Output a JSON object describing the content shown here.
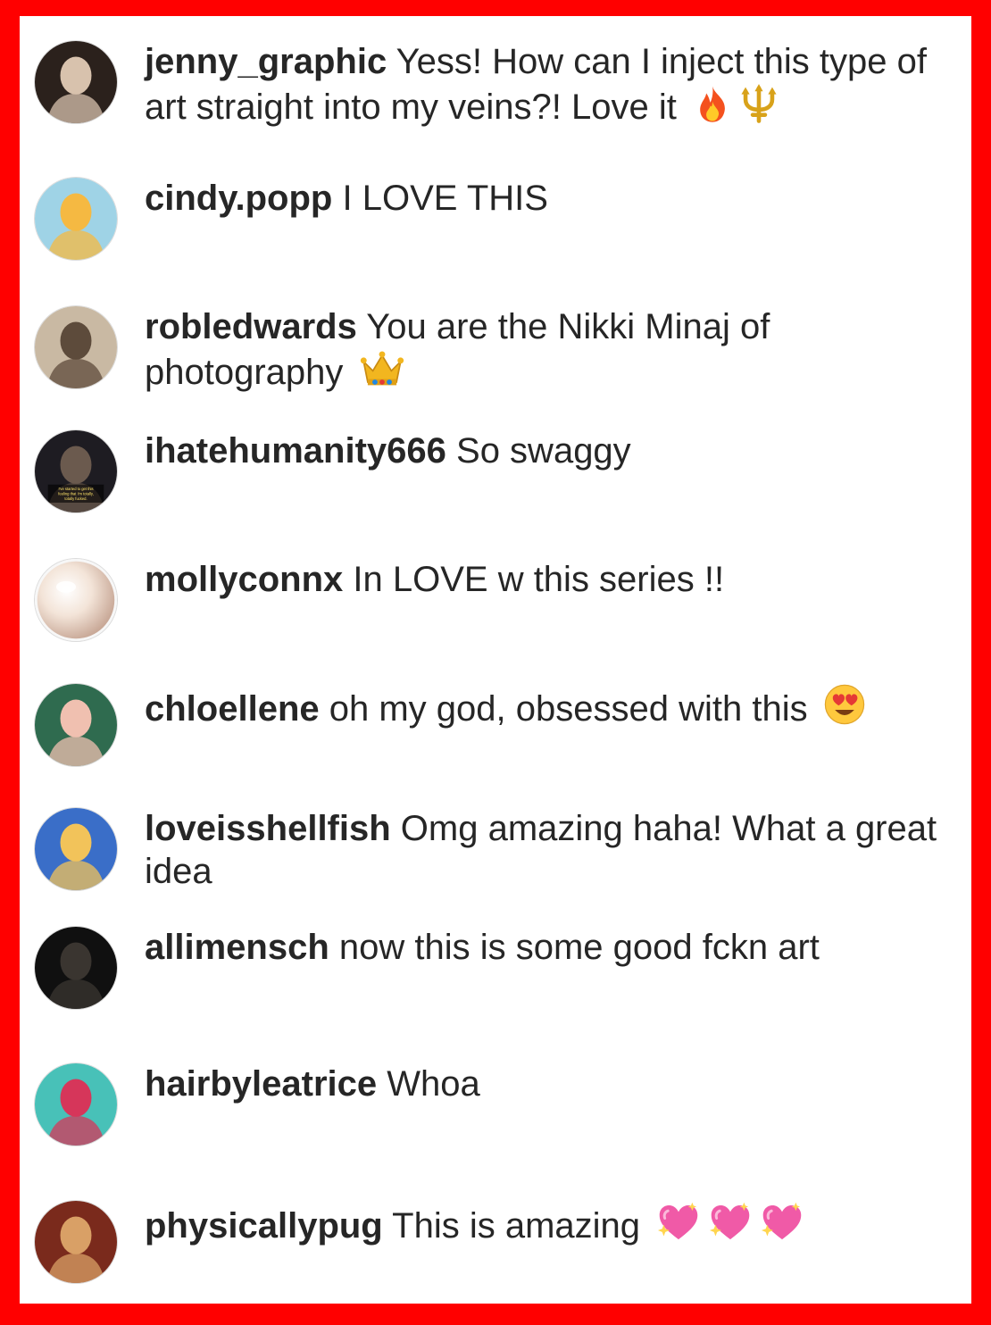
{
  "comments": [
    {
      "username": "jenny_graphic",
      "text": "Yess! How can I inject this type of art straight into my veins?! Love it",
      "emojis": [
        "fire-icon",
        "trident-icon"
      ],
      "avatar": {
        "bg": "#2b211c",
        "fg": "#d8c2ad"
      }
    },
    {
      "username": "cindy.popp",
      "text": "I LOVE THIS",
      "emojis": [],
      "avatar": {
        "bg": "#9fd3e6",
        "fg": "#f5b942"
      }
    },
    {
      "username": "robledwards",
      "text": "You are the Nikki Minaj of photography",
      "emojis": [
        "crown-icon"
      ],
      "avatar": {
        "bg": "#c9b9a3",
        "fg": "#5d4b3b"
      }
    },
    {
      "username": "ihatehumanity666",
      "text": "So swaggy",
      "emojis": [],
      "avatar": {
        "bg": "#1e1c22",
        "fg": "#6b5a4e",
        "caption": [
          "I've started to get this",
          "feeling that I'm totally,",
          "totally fucked."
        ]
      }
    },
    {
      "username": "mollyconnx",
      "text": "In LOVE w this series !!",
      "emojis": [],
      "avatar": {
        "bg": "#f3e4d8",
        "fg": "#fdf7f1"
      }
    },
    {
      "username": "chloellene",
      "text": "oh my god, obsessed with this",
      "emojis": [
        "heart-eyes-icon"
      ],
      "avatar": {
        "bg": "#2f6b4f",
        "fg": "#f0c0b0"
      }
    },
    {
      "username": "loveisshellfish",
      "text": "Omg amazing haha! What a great idea",
      "emojis": [],
      "avatar": {
        "bg": "#3a6ec8",
        "fg": "#f2c35a"
      }
    },
    {
      "username": "allimensch",
      "text": "now this is some good fckn art",
      "emojis": [],
      "avatar": {
        "bg": "#101010",
        "fg": "#3a3530"
      }
    },
    {
      "username": "hairbyleatrice",
      "text": "Whoa",
      "emojis": [],
      "avatar": {
        "bg": "#48c1b8",
        "fg": "#d6365a"
      }
    },
    {
      "username": "physicallypug",
      "text": "This is amazing",
      "emojis": [
        "sparkling-heart-icon",
        "sparkling-heart-icon",
        "sparkling-heart-icon"
      ],
      "avatar": {
        "bg": "#7a2a1c",
        "fg": "#d9a066"
      }
    }
  ]
}
